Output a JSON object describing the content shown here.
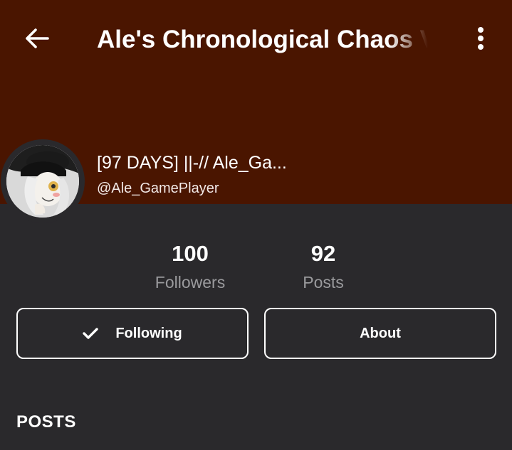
{
  "colors": {
    "header_bg": "#4a1500",
    "page_bg": "#2a292c",
    "text_primary": "#ffffff",
    "text_muted": "#9a9a9d"
  },
  "header": {
    "back_icon": "arrow-left-icon",
    "title": "Ale's Chronological Chaos V",
    "more_icon": "more-vertical-icon"
  },
  "profile": {
    "display_name": "[97 DAYS] ||-// Ale_Ga...",
    "username": "@Ale_GamePlayer"
  },
  "stats": [
    {
      "value": "100",
      "label": "Followers"
    },
    {
      "value": "92",
      "label": "Posts"
    }
  ],
  "actions": {
    "following_label": "Following",
    "following_icon": "check-icon",
    "about_label": "About"
  },
  "sections": {
    "posts_heading": "POSTS"
  }
}
